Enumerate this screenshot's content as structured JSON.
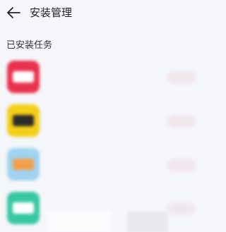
{
  "header": {
    "back_icon": "back-arrow-icon",
    "title": "安装管理"
  },
  "section": {
    "title": "已安装任务"
  },
  "colors": {
    "accent": "#e0506a",
    "background": "#f5f6fa"
  },
  "items": [
    {
      "icon": "red-app-icon",
      "icon_color": "#e8314d",
      "inner_color": "#ffffff",
      "name": "",
      "sub": "",
      "action": ""
    },
    {
      "icon": "yellow-app-icon",
      "icon_color": "#f3cf18",
      "inner_color": "#2b2b2b",
      "name": "",
      "sub": "",
      "action": ""
    },
    {
      "icon": "colorful-app-icon",
      "icon_color": "#9fd3f0",
      "inner_color": "#f3a04a",
      "name": "",
      "sub": "",
      "action": ""
    },
    {
      "icon": "green-app-icon",
      "icon_color": "#37c7a3",
      "inner_color": "#ffffff",
      "name": "",
      "sub": "",
      "action": ""
    }
  ]
}
